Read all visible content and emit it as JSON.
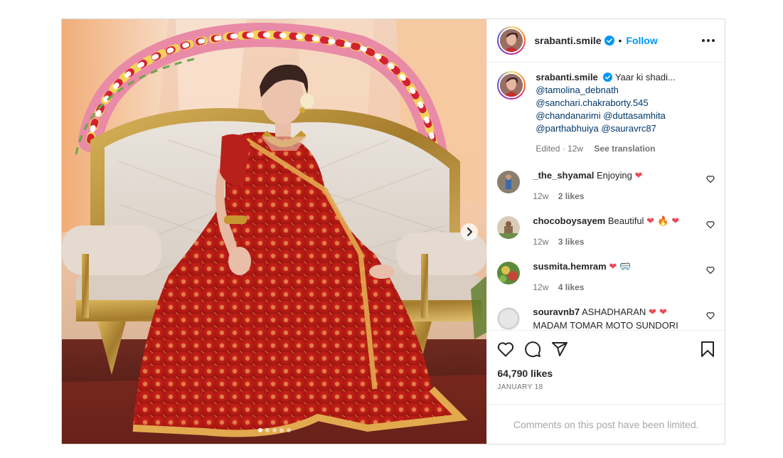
{
  "post": {
    "author": "srabanti.smile",
    "follow_label": "Follow",
    "separator": "•",
    "caption": {
      "text": "Yaar ki shadi...",
      "mentions": [
        "@tamolina_debnath",
        "@sanchari.chakraborty.545"
      ],
      "mentions_line3": [
        "@chandanarimi",
        "@duttasamhita"
      ],
      "mentions_line4": [
        "@parthabhuiya",
        "@sauravrc87"
      ],
      "edited": "Edited · 12w",
      "translate": "See translation"
    },
    "comments": [
      {
        "user": "_the_shyamal",
        "text": "Enjoying",
        "emoji": "❤",
        "age": "12w",
        "likes": "2 likes",
        "avatar_color": "#8a7f6e"
      },
      {
        "user": "chocoboysayem",
        "text": "Beautiful",
        "emoji": "❤ 🔥 ❤",
        "age": "12w",
        "likes": "3 likes",
        "avatar_color": "#b9a894"
      },
      {
        "user": "susmita.hemram",
        "text": "",
        "emoji": "❤ 🥽",
        "age": "12w",
        "likes": "4 likes",
        "avatar_color": "#5c8a3a"
      },
      {
        "user": "souravnb7",
        "text": "ASHADHARAN",
        "emoji": "❤ ❤",
        "text2": "MADAM TOMAR MOTO SUNDORI",
        "age": "",
        "likes": "",
        "avatar_color": "#e6e6e6"
      }
    ],
    "likes": "64,790 likes",
    "date": "JANUARY 18",
    "comments_limited": "Comments on this post have been limited.",
    "carousel": {
      "count": 5,
      "active": 0
    }
  },
  "colors": {
    "link": "#00376b",
    "follow": "#0095f6",
    "verified": "#0095f6",
    "muted": "#737373",
    "heart": "#ed4956"
  },
  "icons": [
    "more-options-icon",
    "verified-badge-icon",
    "heart-icon",
    "comment-icon",
    "share-icon",
    "save-icon",
    "chevron-right-icon"
  ]
}
